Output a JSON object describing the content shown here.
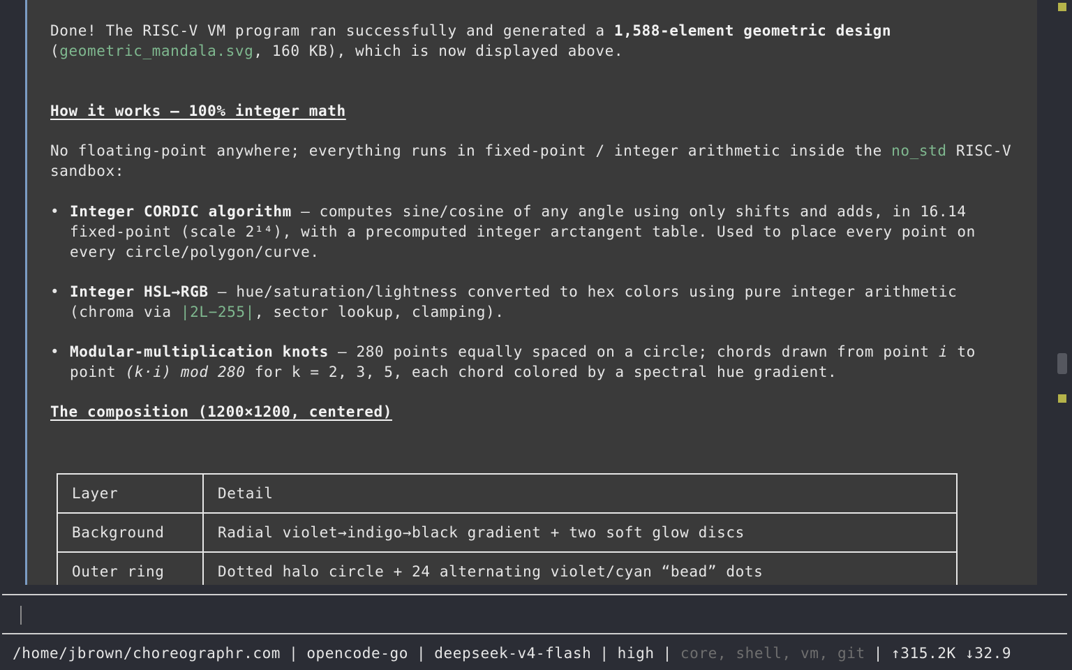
{
  "message": {
    "intro": {
      "t1": "Done! The RISC-V VM program ran successfully and generated a ",
      "b1": "1,588-element geometric design",
      "t2": " (",
      "file": "geometric_mandala.svg",
      "t3": ", 160 KB), which is now displayed above."
    },
    "heading1": "How it works — 100% integer math",
    "para2": {
      "t1": "No floating-point anywhere; everything runs in fixed-point / integer arithmetic inside the ",
      "code": "no_std",
      "t2": " RISC-V sandbox:"
    },
    "bullets": [
      {
        "title": "Integer CORDIC algorithm",
        "t1": " — computes sine/cosine of any angle using only shifts and adds, in 16.14 fixed-point (scale 2¹⁴), with a precomputed integer arctangent table. Used to place every point on every circle/polygon/curve."
      },
      {
        "title": "Integer HSL→RGB",
        "t1": " — hue/saturation/lightness converted to hex colors using pure integer arithmetic (chroma via ",
        "code": "|2L−255|",
        "t2": ", sector lookup, clamping)."
      },
      {
        "title": "Modular-multiplication knots",
        "t1": " — 280 points equally spaced on a circle; chords drawn from point ",
        "i1": "i",
        "t2": " to point ",
        "i2": "(k·i) mod 280",
        "t3": " for k = 2, 3, 5, each chord colored by a spectral hue gradient."
      }
    ],
    "heading2": "The composition (1200×1200, centered)",
    "table": {
      "headers": [
        "Layer",
        "Detail"
      ],
      "rows": [
        [
          "Background",
          "Radial violet→indigo→black gradient + two soft glow discs"
        ],
        [
          "Outer ring",
          "Dotted halo circle + 24 alternating violet/cyan “bead” dots"
        ]
      ]
    }
  },
  "input": {
    "value": ""
  },
  "status": {
    "path": "/home/jbrown/choreographr.com",
    "agent": "opencode-go",
    "model": "deepseek-v4-flash",
    "effort": "high",
    "tools": "core, shell, vm, git",
    "tokens": "↑315.2K ↓32.9",
    "separator": "|"
  },
  "colors": {
    "accent_green": "#7fb88f",
    "border_blue": "#7b9cc4",
    "scroll_marker": "#b5b34a",
    "panel_bg": "#3a3a3a",
    "app_bg": "#2b2d35"
  }
}
